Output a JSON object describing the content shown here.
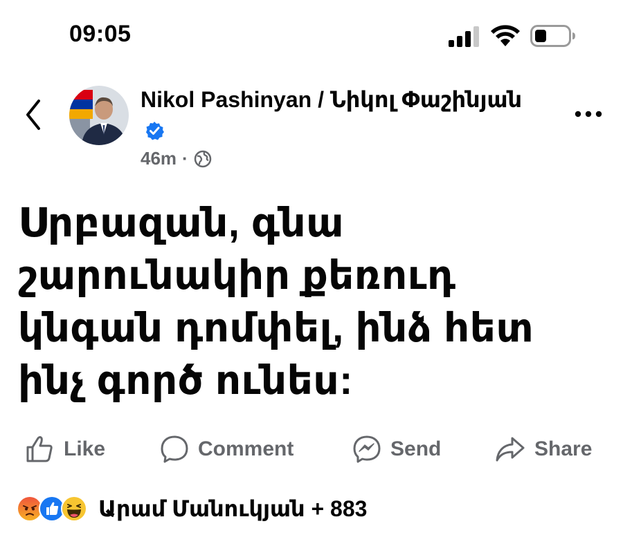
{
  "status_bar": {
    "time": "09:05",
    "signal_icon": "cellular-signal-icon",
    "wifi_icon": "wifi-icon",
    "battery_icon": "battery-low-icon"
  },
  "post": {
    "author": "Nikol Pashinyan / Նիկոլ Փաշինյան",
    "verified": true,
    "time_ago": "46m",
    "separator": "·",
    "audience_icon": "globe-icon",
    "text": "Սրբազան, գնա շարունակիր քեռուդ կնգան դոմփել, ինձ հետ ինչ գործ ունես:"
  },
  "actions": {
    "like": "Like",
    "comment": "Comment",
    "send": "Send",
    "share": "Share"
  },
  "reactions": {
    "icons": [
      "angry-reaction-icon",
      "like-reaction-icon",
      "haha-reaction-icon"
    ],
    "summary": "Արամ Մանուկյան + 883"
  },
  "colors": {
    "text_primary": "#050505",
    "text_secondary": "#65676b",
    "verified_blue": "#1877f2"
  }
}
